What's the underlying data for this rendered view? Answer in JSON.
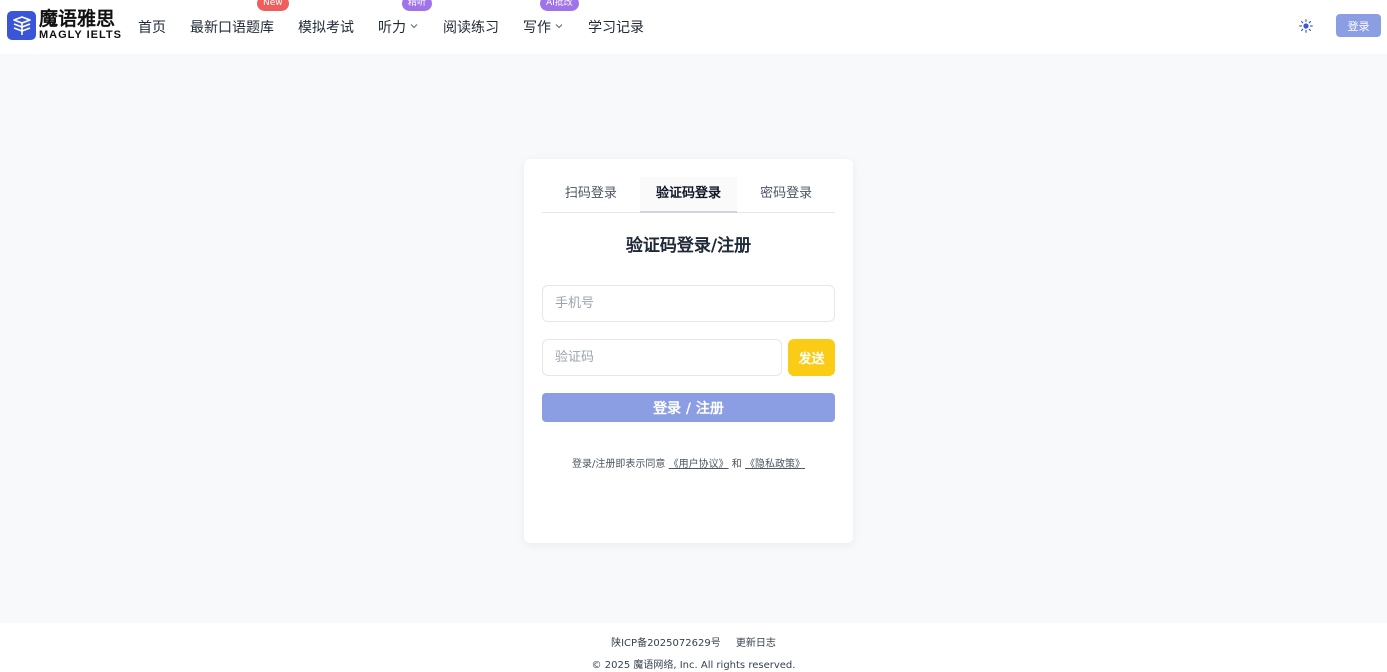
{
  "header": {
    "logo_cn": "魔语雅思",
    "logo_en": "MAGLY IELTS",
    "nav": [
      {
        "label": "首页"
      },
      {
        "label": "最新口语题库",
        "badge": "New"
      },
      {
        "label": "模拟考试"
      },
      {
        "label": "听力",
        "badge": "精听",
        "dropdown": true
      },
      {
        "label": "阅读练习"
      },
      {
        "label": "写作",
        "badge": "AI批改",
        "dropdown": true
      },
      {
        "label": "学习记录"
      }
    ],
    "login_label": "登录"
  },
  "login": {
    "tabs": [
      {
        "label": "扫码登录",
        "active": false
      },
      {
        "label": "验证码登录",
        "active": true
      },
      {
        "label": "密码登录",
        "active": false
      }
    ],
    "title": "验证码登录/注册",
    "phone_placeholder": "手机号",
    "code_placeholder": "验证码",
    "send_label": "发送",
    "submit_label": "登录 / 注册",
    "agree_prefix": "登录/注册即表示同意",
    "user_agreement": "《用户协议》",
    "and": "和",
    "privacy_policy": "《隐私政策》"
  },
  "footer": {
    "icp": "陕ICP备2025072629号",
    "changelog": "更新日志",
    "copyright": "© 2025 魔语网络, Inc. All rights reserved."
  },
  "colors": {
    "primary": "#8b9ee3",
    "send": "#facc15",
    "badge_new": "#ef5d5d",
    "badge_purple": "#a073e8",
    "logo": "#3b55d9"
  },
  "icons": {
    "logo": "book-stack-icon",
    "theme": "sun-icon",
    "dropdown": "chevron-down-icon"
  }
}
